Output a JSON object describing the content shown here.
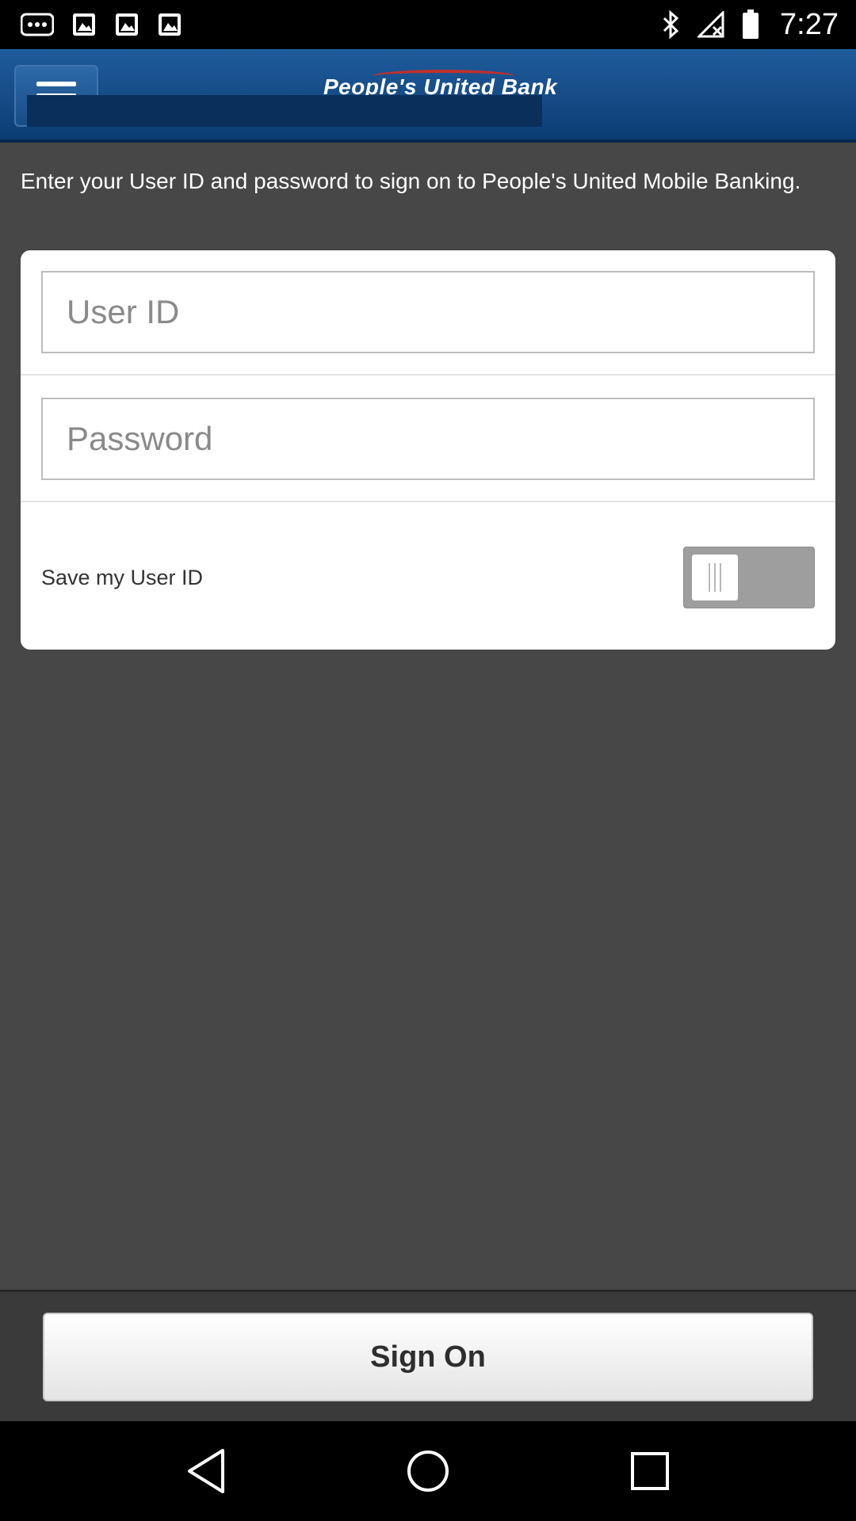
{
  "status_bar": {
    "time": "7:27",
    "icons": [
      "more-icon",
      "image-icon",
      "image-icon",
      "image-icon",
      "bluetooth-icon",
      "signal-off-icon",
      "battery-icon"
    ]
  },
  "header": {
    "brand_name": "People's United Bank",
    "menu_icon": "menu-icon"
  },
  "main": {
    "intro_text": "Enter your User ID and password to sign on to People's United Mobile Banking.",
    "form": {
      "user_id": {
        "placeholder": "User ID",
        "value": ""
      },
      "password": {
        "placeholder": "Password",
        "value": ""
      },
      "save_user_id": {
        "label": "Save my User ID",
        "enabled": false
      }
    }
  },
  "footer": {
    "sign_on_label": "Sign On"
  },
  "nav_bar": {
    "icons": [
      "back-icon",
      "home-icon",
      "recents-icon"
    ]
  },
  "colors": {
    "header_blue": "#0c3d74",
    "background": "#474747",
    "card": "#ffffff"
  }
}
